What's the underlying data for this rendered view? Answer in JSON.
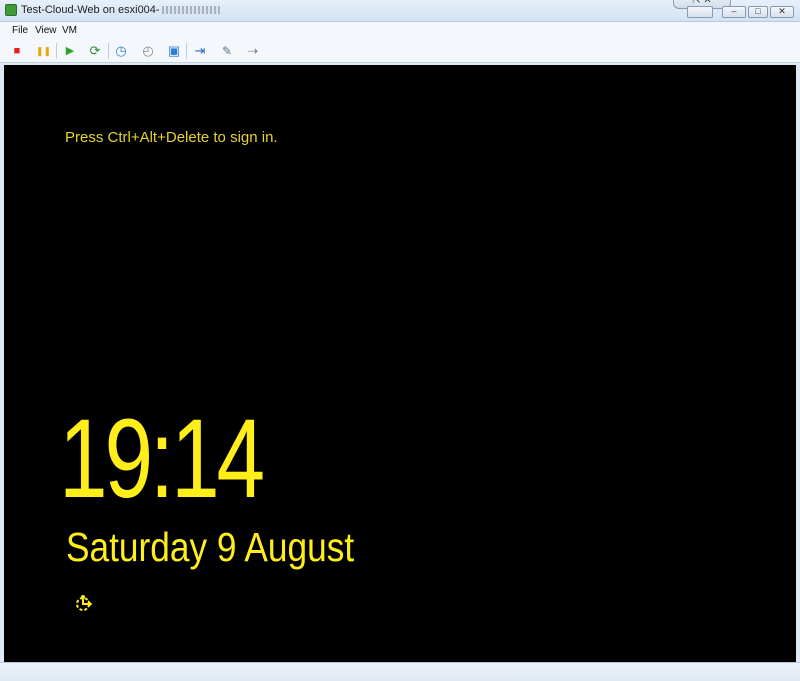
{
  "window": {
    "title": "Test-Cloud-Web on esxi004-",
    "app_icon": "vm-console-icon",
    "controls": {
      "restore_tab": "⇱ ✕",
      "minimize": "–",
      "maximize": "□",
      "close": "✕"
    }
  },
  "menu": {
    "items": [
      "File",
      "View",
      "VM"
    ]
  },
  "toolbar": {
    "buttons": [
      {
        "name": "power-off-icon",
        "glyph": "■",
        "color": "#e02020"
      },
      {
        "name": "suspend-icon",
        "glyph": "❚❚",
        "color": "#e6a800"
      },
      {
        "name": "power-on-icon",
        "glyph": "▶",
        "color": "#2fa52f"
      },
      {
        "name": "reset-icon",
        "glyph": "⟳",
        "color": "#2f8f2f"
      },
      {
        "name": "snapshot-icon",
        "glyph": "◷",
        "color": "#2b7fd3"
      },
      {
        "name": "revert-snapshot-icon",
        "glyph": "◴",
        "color": "#8a8a8a"
      },
      {
        "name": "snapshot-manager-icon",
        "glyph": "▣",
        "color": "#2b7fd3"
      },
      {
        "name": "connect-device-icon",
        "glyph": "⇥",
        "color": "#2b6fbf"
      },
      {
        "name": "settings-icon",
        "glyph": "✎",
        "color": "#5a6f8a"
      },
      {
        "name": "disconnect-icon",
        "glyph": "⇢",
        "color": "#7b7b7b"
      }
    ]
  },
  "console": {
    "background": "#000000",
    "accent": "#ffee1a",
    "prompt": "Press Ctrl+Alt+Delete to sign in.",
    "time": "19:14",
    "date": "Saturday 9 August",
    "ease_of_access_icon": "ease-of-access-icon"
  }
}
